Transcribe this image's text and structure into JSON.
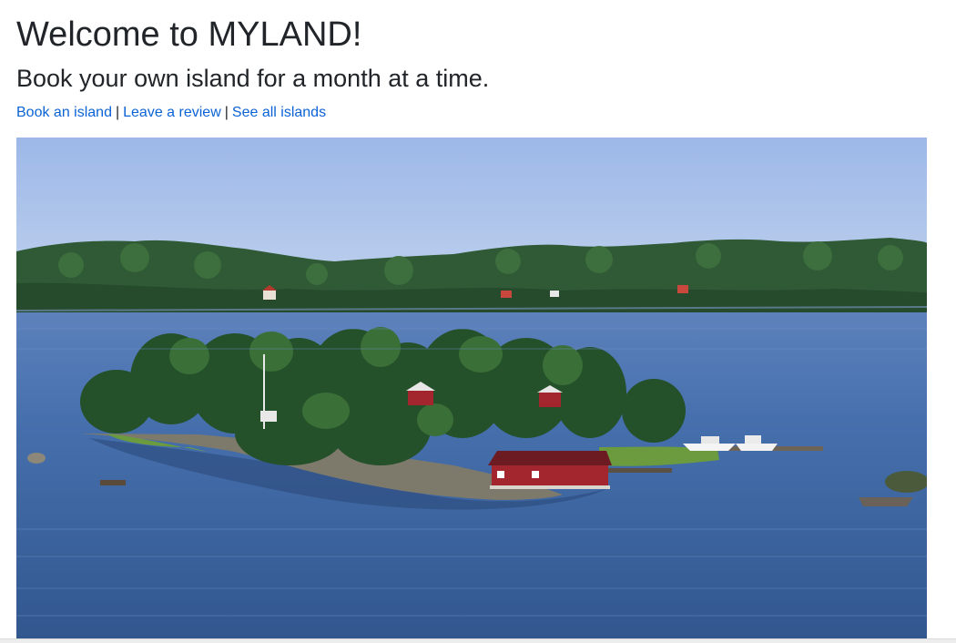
{
  "header": {
    "title": "Welcome to MYLAND!",
    "subtitle": "Book your own island for a month at a time."
  },
  "nav": {
    "links": [
      {
        "label": "Book an island"
      },
      {
        "label": "Leave a review"
      },
      {
        "label": "See all islands"
      }
    ],
    "separator": "|"
  },
  "colors": {
    "link": "#0b63d6",
    "text": "#212529",
    "sky": "#a9c1ea",
    "water": "#3f6aa6",
    "forest": "#2d5a32",
    "cabin": "#a3252d"
  }
}
